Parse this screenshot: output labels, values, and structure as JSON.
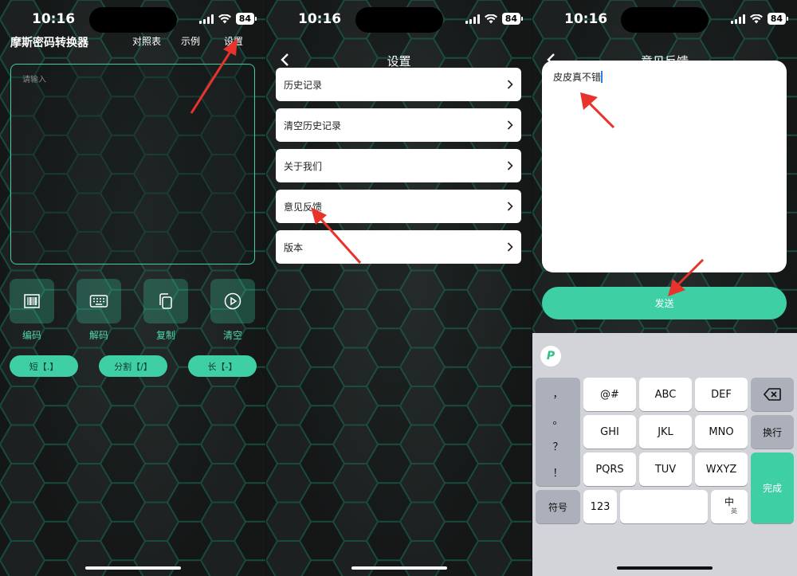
{
  "status": {
    "time": "10:16",
    "battery": "84"
  },
  "screen1": {
    "app_title": "摩斯密码转换器",
    "nav": [
      "对照表",
      "示例",
      "设置"
    ],
    "input_placeholder": "请输入",
    "actions": [
      {
        "label": "编码",
        "icon": "barcode-icon"
      },
      {
        "label": "解码",
        "icon": "keyboard-icon"
      },
      {
        "label": "复制",
        "icon": "copy-icon"
      },
      {
        "label": "清空",
        "icon": "play-circle-icon"
      }
    ],
    "pills": [
      "短【.】",
      "分割【/】",
      "长【-】"
    ]
  },
  "screen2": {
    "title": "设置",
    "items": [
      "历史记录",
      "清空历史记录",
      "关于我们",
      "意见反馈",
      "版本"
    ]
  },
  "screen3": {
    "title": "意见反馈",
    "feedback_text": "皮皮真不错",
    "send_label": "发送",
    "keyboard": {
      "punct": [
        "，",
        "。",
        "？",
        "！"
      ],
      "rows": [
        [
          "@#",
          "ABC",
          "DEF"
        ],
        [
          "GHI",
          "JKL",
          "MNO"
        ],
        [
          "PQRS",
          "TUV",
          "WXYZ"
        ]
      ],
      "switch_label": "换行",
      "done_label": "完成",
      "symbols_label": "符号",
      "num_label": "123",
      "lang_label": "中",
      "lang_sub": "英"
    }
  },
  "colors": {
    "accent": "#3ecfa5",
    "arrow": "#e8322c"
  }
}
